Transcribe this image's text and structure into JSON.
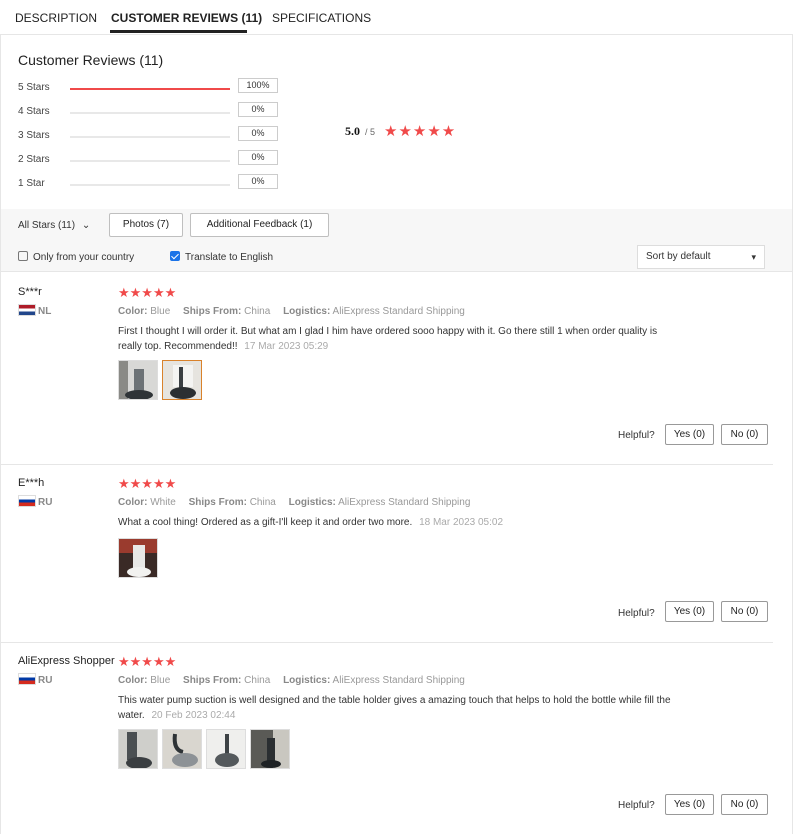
{
  "tabs": [
    {
      "label": "DESCRIPTION"
    },
    {
      "label": "CUSTOMER REVIEWS (11)"
    },
    {
      "label": "SPECIFICATIONS"
    }
  ],
  "summary": {
    "title": "Customer Reviews (11)",
    "distribution": [
      {
        "label": "5 Stars",
        "pct": "100%",
        "fraction": 1.0
      },
      {
        "label": "4 Stars",
        "pct": "0%",
        "fraction": 0
      },
      {
        "label": "3 Stars",
        "pct": "0%",
        "fraction": 0
      },
      {
        "label": "2 Stars",
        "pct": "0%",
        "fraction": 0
      },
      {
        "label": "1 Star",
        "pct": "0%",
        "fraction": 0
      }
    ],
    "score": "5.0",
    "score_max": "/ 5",
    "stars": "★★★★★"
  },
  "filters": {
    "all_stars": "All Stars (11)",
    "all_stars_chevron": "⌄",
    "photos": "Photos (7)",
    "additional": "Additional Feedback (1)",
    "only_country": "Only from your country",
    "only_country_checked": false,
    "translate": "Translate to English",
    "translate_checked": true,
    "sort_value": "Sort by default",
    "sort_chevron": "▾"
  },
  "labels": {
    "color": "Color:",
    "ships_from": "Ships From:",
    "logistics": "Logistics:",
    "helpful": "Helpful?",
    "yes": "Yes (0)",
    "no": "No (0)"
  },
  "reviews": [
    {
      "name": "S***r",
      "country": "NL",
      "flag": "nl",
      "stars": "★★★★★",
      "color": "Blue",
      "ships_from": "China",
      "logistics": "AliExpress Standard Shipping",
      "text": "First I thought I will order it. But what am I glad I him have ordered sooo happy with it. Go there still 1 when order quality is really top. Recommended!!",
      "date": "17 Mar 2023 05:29",
      "photos": 2,
      "selected_photo": 1
    },
    {
      "name": "E***h",
      "country": "RU",
      "flag": "ru",
      "stars": "★★★★★",
      "color": "White",
      "ships_from": "China",
      "logistics": "AliExpress Standard Shipping",
      "text": "What a cool thing! Ordered as a gift-I'll keep it and order two more.",
      "date": "18 Mar 2023 05:02",
      "photos": 1,
      "selected_photo": -1
    },
    {
      "name": "AliExpress Shopper",
      "country": "RU",
      "flag": "ru",
      "stars": "★★★★★",
      "color": "Blue",
      "ships_from": "China",
      "logistics": "AliExpress Standard Shipping",
      "text": "This water pump suction is well designed and the table holder gives a amazing touch that helps to hold the bottle while fill the water.",
      "date": "20 Feb 2023 02:44",
      "photos": 4,
      "selected_photo": -1
    }
  ]
}
